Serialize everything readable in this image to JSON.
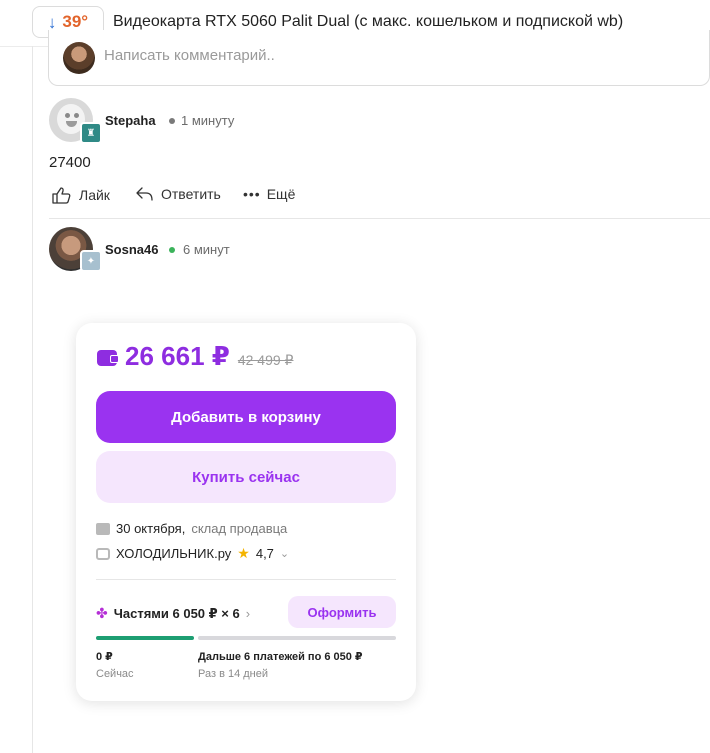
{
  "topbar": {
    "vote_arrow": "↓",
    "temperature": "39°",
    "deal_title": "Видеокарта RTX 5060 Palit Dual (с макс. кошельком и подпиской wb)"
  },
  "comment_input": {
    "placeholder": "Написать комментарий.."
  },
  "comments": [
    {
      "username": "Stepaha",
      "time_ago": "1 минуту",
      "status_color": "#7a7a7a",
      "text": "27400",
      "actions": {
        "like": "Лайк",
        "reply": "Ответить",
        "more": "Ещё"
      }
    },
    {
      "username": "Sosna46",
      "time_ago": "6 минут",
      "status_color": "#3bb35b"
    }
  ],
  "product_card": {
    "price": "26 661 ₽",
    "old_price": "42 499 ₽",
    "add_to_cart": "Добавить в корзину",
    "buy_now": "Купить сейчас",
    "delivery_date": "30 октября,",
    "delivery_source": "склад продавца",
    "seller": "ХОЛОДИЛЬНИК.ру",
    "rating": "4,7",
    "installments": "Частями 6 050 ₽ × 6",
    "checkout": "Оформить",
    "now_amount": "0 ₽",
    "now_label": "Сейчас",
    "later_amount": "Дальше 6 платежей по 6 050 ₽",
    "later_label": "Раз в 14 дней"
  },
  "colors": {
    "accent": "#9a33f0",
    "accent_light": "#f5e6fd",
    "hot": "#e2642b",
    "vote_arrow": "#2d6fd3",
    "progress_now": "#1d9e72"
  }
}
